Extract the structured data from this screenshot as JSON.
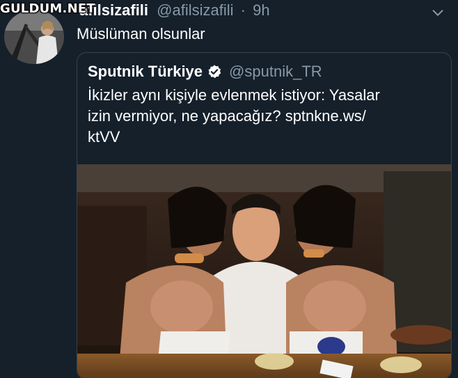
{
  "watermark": "GULDUM.NET",
  "tweet": {
    "display_name": "afilsizafili",
    "handle": "@afilsizafili",
    "separator": "·",
    "time": "9h",
    "text": "Müslüman olsunlar",
    "menu_icon": "chevron-down-icon"
  },
  "quote": {
    "display_name": "Sputnik Türkiye",
    "verified_icon": "verified-badge-icon",
    "handle": "@sputnik_TR",
    "text_lines": [
      "İkizler aynı kişiyle evlenmek istiyor: Yasalar",
      "izin vermiyor, ne yapacağız? sptnkne.ws/",
      "ktVV"
    ]
  },
  "colors": {
    "background": "#15202b",
    "secondary_text": "#8899a6",
    "border": "#38444d",
    "verified": "#ffffff"
  }
}
